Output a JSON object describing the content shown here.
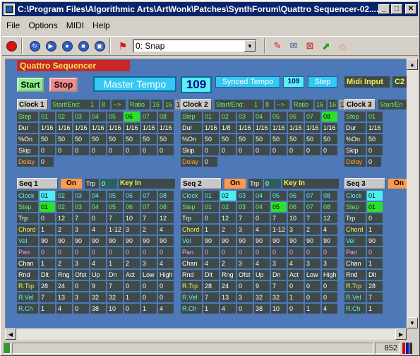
{
  "window": {
    "title": "C:\\Program Files\\Algorithmic Arts\\ArtWonk\\Patches\\SynthForum\\Quattro Sequencer-02....",
    "min": "_",
    "max": "□",
    "close": "✕"
  },
  "menu": [
    "File",
    "Options",
    "MIDI",
    "Help"
  ],
  "toolbar": {
    "snap_value": "0: Snap",
    "icons": [
      "record-icon",
      "refresh-icon",
      "play-icon",
      "stop-icon",
      "step-icon",
      "flag-icon",
      "pin-icon",
      "chat-icon",
      "close-box-icon",
      "arrow-icon",
      "home-icon"
    ]
  },
  "panel": {
    "title": "Quattro Sequencer",
    "start": "Start",
    "stop": "Stop",
    "master_tempo": "Master Tempo",
    "tempo": "109",
    "synced_tempo": "Synced Tempo",
    "synced_value": "109",
    "step": "Step",
    "midi_input": "Midi Input",
    "c2": "C2"
  },
  "clocks": [
    {
      "title": "Clock 1",
      "startend_label": "Start/End:",
      "start": "1",
      "end": "8",
      "arrow": "-->",
      "ratio_label": "Ratio",
      "r1": "16",
      "r2": "16",
      "r3": "1",
      "step": [
        "01",
        "02",
        "03",
        "04",
        "05",
        "06",
        "07",
        "08"
      ],
      "dur": [
        "1/16",
        "1/16",
        "1/16",
        "1/16",
        "1/16",
        "1/16",
        "1/16",
        "1/16"
      ],
      "on": [
        "50",
        "50",
        "50",
        "50",
        "50",
        "50",
        "50",
        "50"
      ],
      "skip": [
        "0",
        "0",
        "0",
        "0",
        "0",
        "0",
        "0",
        "0"
      ],
      "delay": "0",
      "active_step": 5
    },
    {
      "title": "Clock 2",
      "startend_label": "Start/End:",
      "start": "1",
      "end": "8",
      "arrow": "-->",
      "ratio_label": "Ratio",
      "r1": "16",
      "r2": "16",
      "r3": "1",
      "step": [
        "01",
        "02",
        "03",
        "04",
        "05",
        "06",
        "07",
        "08"
      ],
      "dur": [
        "1/16",
        "1/8",
        "1/16",
        "1/16",
        "1/16",
        "1/16",
        "1/16",
        "1/16"
      ],
      "on": [
        "50",
        "50",
        "50",
        "50",
        "50",
        "50",
        "50",
        "50"
      ],
      "skip": [
        "0",
        "0",
        "0",
        "0",
        "0",
        "0",
        "0",
        "0"
      ],
      "delay": "0",
      "active_step": 7
    },
    {
      "title": "Clock 3",
      "startend_label": "Start/En",
      "step": [
        "01"
      ],
      "dur": [
        "1/16"
      ],
      "on": [
        "50"
      ],
      "skip": [
        "0"
      ],
      "delay": "0"
    }
  ],
  "row_labels": {
    "step": "Step",
    "dur": "Dur",
    "on": "%On",
    "skip": "Skip",
    "delay": "Delay"
  },
  "seqs": [
    {
      "title": "Seq 1",
      "on": "On",
      "trp": "Trp",
      "trp_val": "0",
      "keyin": "Key In",
      "clock": [
        "01",
        "02",
        "03",
        "04",
        "05",
        "06",
        "07",
        "08"
      ],
      "step": [
        "01",
        "02",
        "03",
        "04",
        "05",
        "06",
        "07",
        "08"
      ],
      "trp_row": [
        "0",
        "12",
        "7",
        "0",
        "7",
        "10",
        "7",
        "12"
      ],
      "chord": [
        "1",
        "2",
        "3",
        "4",
        "1-12",
        "3",
        "2",
        "4"
      ],
      "vel": [
        "90",
        "90",
        "90",
        "90",
        "90",
        "90",
        "90",
        "90"
      ],
      "pan": [
        "0",
        "0",
        "0",
        "0",
        "0",
        "0",
        "0",
        "0"
      ],
      "chan": [
        "1",
        "2",
        "3",
        "4",
        "1",
        "2",
        "3",
        "4"
      ],
      "rnd": [
        "Dlt",
        "Rng",
        "Ofst",
        "Up",
        "Dn",
        "Act",
        "Low",
        "High"
      ],
      "rtrp": [
        "28",
        "24",
        "0",
        "9",
        "7",
        "0",
        "0",
        "0"
      ],
      "rvel": [
        "7",
        "13",
        "3",
        "32",
        "32",
        "1",
        "0",
        "0"
      ],
      "rch": [
        "1",
        "4",
        "0",
        "38",
        "10",
        "0",
        "1",
        "4"
      ],
      "hl_clock": 0,
      "hl_step": 0
    },
    {
      "title": "Seq 2",
      "on": "On",
      "trp": "Trp",
      "trp_val": "0",
      "keyin": "Key In",
      "clock": [
        "01",
        "02",
        "03",
        "04",
        "05",
        "06",
        "07",
        "08"
      ],
      "step": [
        "01",
        "02",
        "03",
        "04",
        "05",
        "06",
        "07",
        "08"
      ],
      "trp_row": [
        "0",
        "12",
        "7",
        "0",
        "7",
        "10",
        "7",
        "12"
      ],
      "chord": [
        "1",
        "2",
        "3",
        "4",
        "1-12",
        "3",
        "2",
        "4"
      ],
      "vel": [
        "90",
        "90",
        "90",
        "90",
        "90",
        "90",
        "90",
        "90"
      ],
      "pan": [
        "0",
        "0",
        "0",
        "0",
        "0",
        "0",
        "0",
        "0"
      ],
      "chan": [
        "4",
        "2",
        "3",
        "4",
        "3",
        "4",
        "3",
        "3"
      ],
      "rnd": [
        "Dlt",
        "Rng",
        "Ofst",
        "Up",
        "Dn",
        "Act",
        "Low",
        "High"
      ],
      "rtrp": [
        "28",
        "24",
        "0",
        "9",
        "7",
        "0",
        "0",
        "0"
      ],
      "rvel": [
        "7",
        "13",
        "3",
        "32",
        "32",
        "1",
        "0",
        "0"
      ],
      "rch": [
        "1",
        "4",
        "0",
        "38",
        "10",
        "0",
        "1",
        "4"
      ],
      "hl_clock": 1,
      "hl_step": 4
    },
    {
      "title": "Seq 3",
      "on": "On",
      "clock": [
        "01"
      ],
      "step": [
        "01"
      ],
      "trp_row": [
        "0"
      ],
      "chord": [
        "1"
      ],
      "vel": [
        "90"
      ],
      "pan": [
        "0"
      ],
      "chan": [
        "1"
      ],
      "rnd": [
        "Dlt"
      ],
      "rtrp": [
        "28"
      ],
      "rvel": [
        "7"
      ],
      "rch": [
        "1"
      ],
      "hl_clock": 0,
      "hl_step": 0
    }
  ],
  "seq_labels": {
    "clock": "Clock",
    "step": "Step",
    "trp": "Trp",
    "chord": "Chord",
    "vel": "Vel",
    "pan": "Pan",
    "chan": "Chan",
    "rnd": "Rnd",
    "rtrp": "R.Trp",
    "rvel": "R.Vel",
    "rch": "R.Ch"
  },
  "status": {
    "value": "852"
  }
}
